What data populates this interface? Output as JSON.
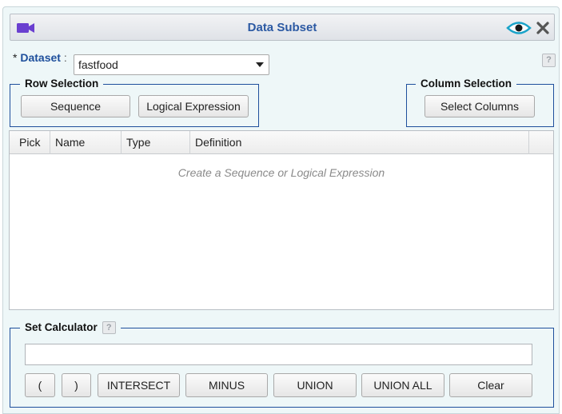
{
  "window": {
    "title": "Data Subset"
  },
  "dataset": {
    "required_mark": "*",
    "label": "Dataset",
    "colon": ":",
    "value": "fastfood",
    "help": "?"
  },
  "row_selection": {
    "legend": "Row Selection",
    "sequence_label": "Sequence",
    "logical_label": "Logical Expression"
  },
  "column_selection": {
    "legend": "Column Selection",
    "select_label": "Select Columns"
  },
  "grid": {
    "columns": [
      "Pick",
      "Name",
      "Type",
      "Definition"
    ],
    "empty_message": "Create a Sequence or Logical Expression"
  },
  "set_calculator": {
    "legend": "Set Calculator",
    "help": "?",
    "input_value": "",
    "buttons": [
      "(",
      ")",
      "INTERSECT",
      "MINUS",
      "UNION",
      "UNION ALL",
      "Clear"
    ]
  },
  "colors": {
    "accent": "#1e4f9c",
    "title": "#2b59a3",
    "icon_purple": "#6a3fd0",
    "icon_teal": "#1aa3c9",
    "panel_bg": "#eef7f8"
  }
}
